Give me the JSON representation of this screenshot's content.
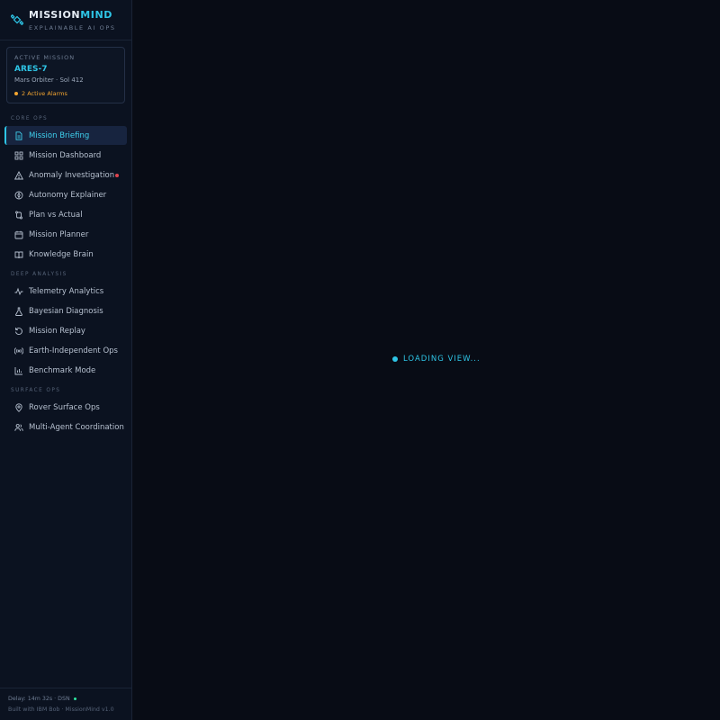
{
  "brand": {
    "title_main": "MISSION",
    "title_accent": "MIND",
    "subtitle": "EXPLAINABLE AI OPS",
    "icon": "satellite-icon"
  },
  "mission": {
    "label": "ACTIVE MISSION",
    "name": "ARES-7",
    "subtitle": "Mars Orbiter · Sol 412",
    "alarms": "2 Active Alarms"
  },
  "sections": {
    "core": "CORE OPS",
    "deep": "DEEP ANALYSIS",
    "surface": "SURFACE OPS"
  },
  "nav": {
    "core": [
      {
        "label": "Mission Briefing",
        "icon": "document-icon"
      },
      {
        "label": "Mission Dashboard",
        "icon": "grid-icon"
      },
      {
        "label": "Anomaly Investigation",
        "icon": "warning-icon"
      },
      {
        "label": "Autonomy Explainer",
        "icon": "compass-icon"
      },
      {
        "label": "Plan vs Actual",
        "icon": "compare-icon"
      },
      {
        "label": "Mission Planner",
        "icon": "calendar-icon"
      },
      {
        "label": "Knowledge Brain",
        "icon": "book-icon"
      }
    ],
    "deep": [
      {
        "label": "Telemetry Analytics",
        "icon": "pulse-icon"
      },
      {
        "label": "Bayesian Diagnosis",
        "icon": "flask-icon"
      },
      {
        "label": "Mission Replay",
        "icon": "replay-icon"
      },
      {
        "label": "Earth-Independent Ops",
        "icon": "broadcast-icon"
      },
      {
        "label": "Benchmark Mode",
        "icon": "bar-chart-icon"
      }
    ],
    "surface": [
      {
        "label": "Rover Surface Ops",
        "icon": "location-pin-icon"
      },
      {
        "label": "Multi-Agent Coordination",
        "icon": "users-icon"
      }
    ]
  },
  "footer": {
    "delay": "Delay: 14m 32s · DSN",
    "built": "Built with IBM Bob · MissionMind v1.0"
  },
  "main": {
    "loading": "LOADING VIEW..."
  },
  "colors": {
    "accent": "#2ec5e6",
    "alarm": "#f4a530",
    "error": "#e0444e",
    "link_ok": "#2ee6a0",
    "background": "#080c15",
    "sidebar": "#0b1220"
  }
}
